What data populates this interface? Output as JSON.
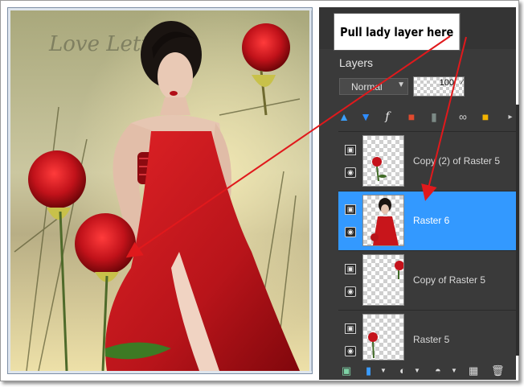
{
  "callout": {
    "text": "Pull lady layer here"
  },
  "canvas": {
    "logo_text": "Love Letters"
  },
  "layers_panel": {
    "title": "Layers",
    "blend_mode": "Normal",
    "opacity": "100",
    "toolbar_icons": [
      "new-raster-layer-icon",
      "new-vector-layer-icon",
      "fx-effects-icon",
      "mask-icon",
      "link-icon",
      "lock-icon"
    ],
    "layers": [
      {
        "name": "Copy (2) of Raster 5",
        "selected": false,
        "content": "rose"
      },
      {
        "name": "Raster 6",
        "selected": true,
        "content": "lady"
      },
      {
        "name": "Copy of Raster 5",
        "selected": false,
        "content": "rose"
      },
      {
        "name": "Raster 5",
        "selected": false,
        "content": "rose"
      }
    ],
    "bottom_icons": [
      "layer-from-image-icon",
      "new-layer-icon",
      "blend-toggle-icon",
      "mask-icon",
      "merge-icon",
      "delete-icon"
    ]
  },
  "colors": {
    "panel_bg": "#3a3a3a",
    "selection": "#3399ff",
    "arrow": "#e0191c",
    "dress": "#c8151b"
  }
}
